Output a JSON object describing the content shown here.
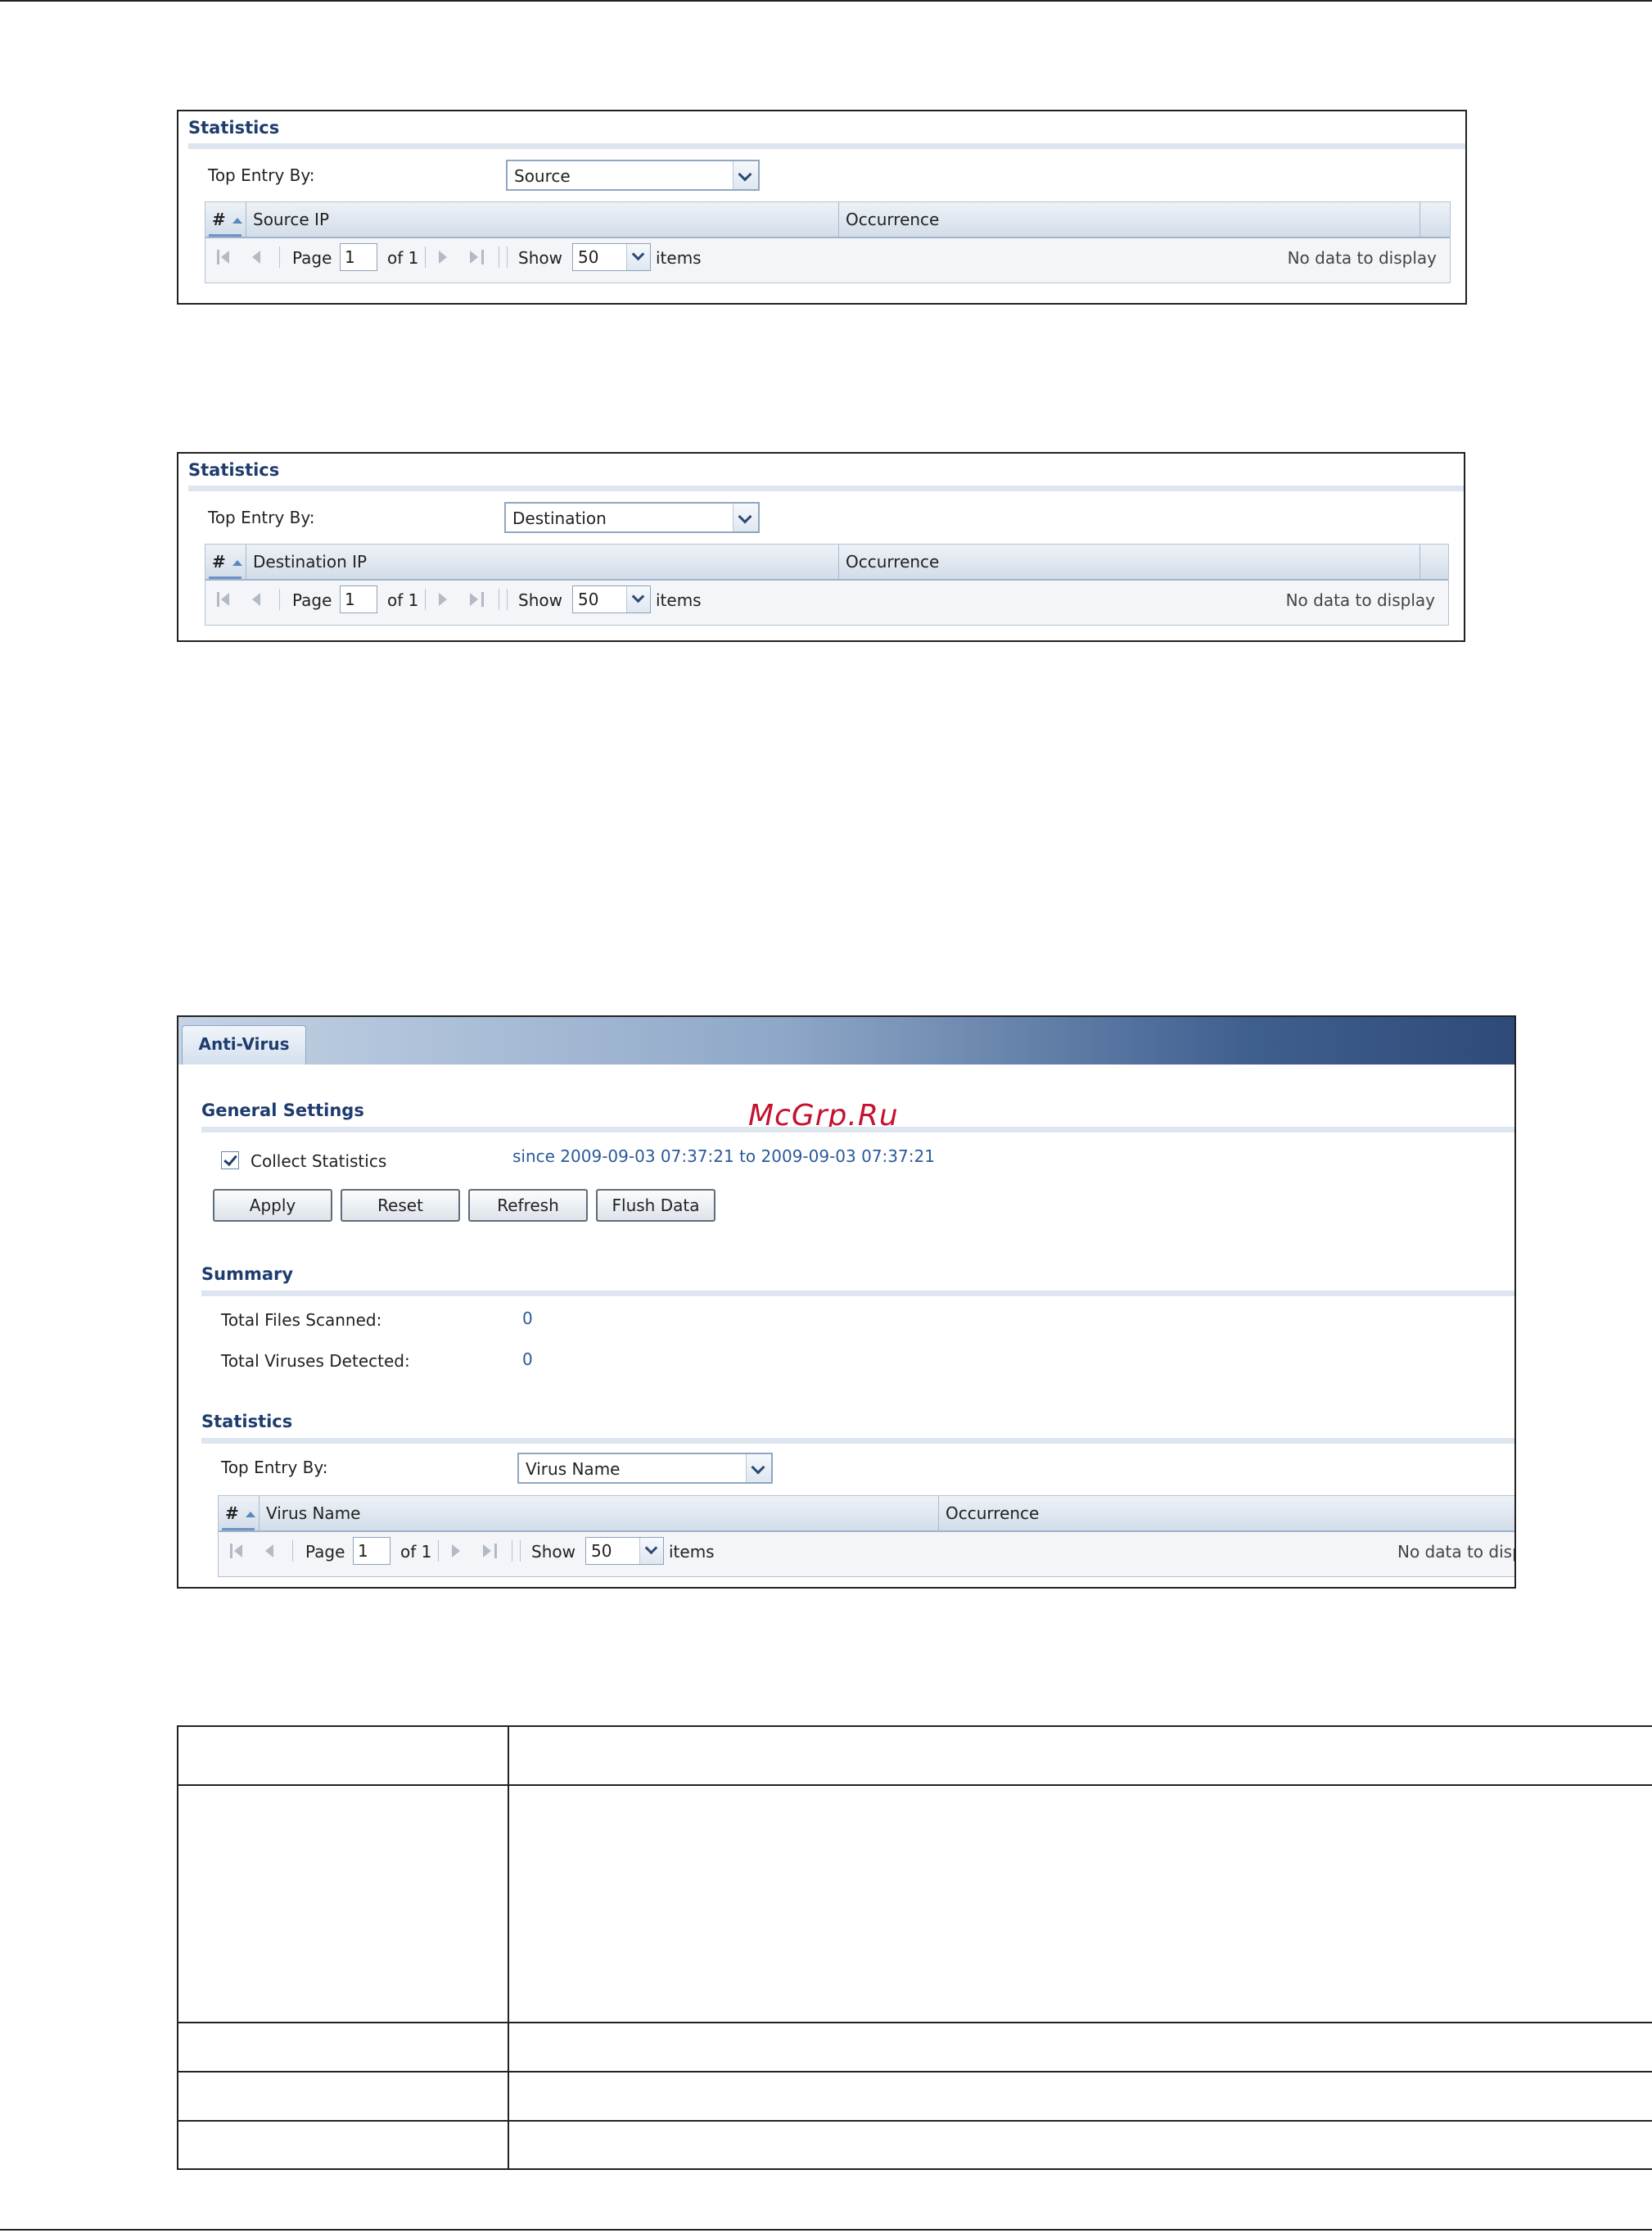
{
  "panel1": {
    "title": "Statistics",
    "top_entry_label": "Top Entry By:",
    "top_entry_value": "Source",
    "columns": [
      "#",
      "Source IP",
      "Occurrence"
    ],
    "pager": {
      "page_label": "Page",
      "page_value": "1",
      "of": "of 1",
      "show_label": "Show",
      "show_value": "50",
      "items_label": "items",
      "empty": "No data to display"
    }
  },
  "panel2": {
    "title": "Statistics",
    "top_entry_label": "Top Entry By:",
    "top_entry_value": "Destination",
    "columns": [
      "#",
      "Destination IP",
      "Occurrence"
    ],
    "pager": {
      "page_label": "Page",
      "page_value": "1",
      "of": "of 1",
      "show_label": "Show",
      "show_value": "50",
      "items_label": "items",
      "empty": "No data to display"
    }
  },
  "panel3": {
    "tab": "Anti-Virus",
    "watermark": "McGrp.Ru",
    "general_settings": {
      "title": "General Settings",
      "collect_label": "Collect Statistics",
      "collect_checked": true,
      "since": "since 2009-09-03 07:37:21 to 2009-09-03 07:37:21",
      "buttons": {
        "apply": "Apply",
        "reset": "Reset",
        "refresh": "Refresh",
        "flush": "Flush Data"
      }
    },
    "summary": {
      "title": "Summary",
      "files_label": "Total Files Scanned:",
      "files_value": "0",
      "viruses_label": "Total Viruses Detected:",
      "viruses_value": "0"
    },
    "statistics": {
      "title": "Statistics",
      "top_entry_label": "Top Entry By:",
      "top_entry_value": "Virus Name",
      "columns": [
        "#",
        "Virus Name",
        "Occurrence"
      ],
      "pager": {
        "page_label": "Page",
        "page_value": "1",
        "of": "of 1",
        "show_label": "Show",
        "show_value": "50",
        "items_label": "items",
        "empty": "No data to disp"
      }
    }
  }
}
